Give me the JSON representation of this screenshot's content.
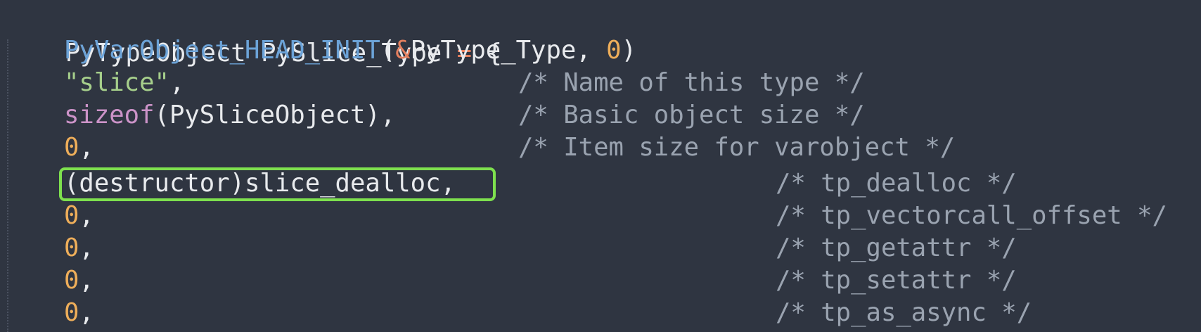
{
  "code": {
    "line1": {
      "type_kw": "PyTypeObject",
      "var_name": "PySlice_Type",
      "assign": "=",
      "brace": "{"
    },
    "line2": {
      "macro": "PyVarObject_HEAD_INIT",
      "open": "(",
      "amp": "&",
      "arg": "PyType_Type",
      "comma": ", ",
      "zero": "0",
      "close": ")"
    },
    "line3": {
      "string": "\"slice\"",
      "comma": ",",
      "comment": "/* Name of this type */"
    },
    "line4": {
      "sizeof": "sizeof",
      "args": "(PySliceObject),",
      "comment": "/* Basic object size */"
    },
    "line5": {
      "zero": "0",
      "comma": ",",
      "comment": "/* Item size for varobject */"
    },
    "line6": {
      "text": "(destructor)slice_dealloc,",
      "comment": "/* tp_dealloc */"
    },
    "line7": {
      "zero": "0",
      "comma": ",",
      "comment": "/* tp_vectorcall_offset */"
    },
    "line8": {
      "zero": "0",
      "comma": ",",
      "comment": "/* tp_getattr */"
    },
    "line9": {
      "zero": "0",
      "comma": ",",
      "comment": "/* tp_setattr */"
    },
    "line10": {
      "zero": "0",
      "comma": ",",
      "comment": "/* tp_as_async */"
    }
  },
  "colors": {
    "background": "#2f3541",
    "text": "#e8eaed",
    "operator": "#e47f5e",
    "macro": "#6ca3d8",
    "number": "#eeae5a",
    "string": "#a6cf8b",
    "keyword_sizeof": "#cc93c8",
    "comment": "#9aa3b0",
    "highlight_box": "#7ee04e"
  }
}
